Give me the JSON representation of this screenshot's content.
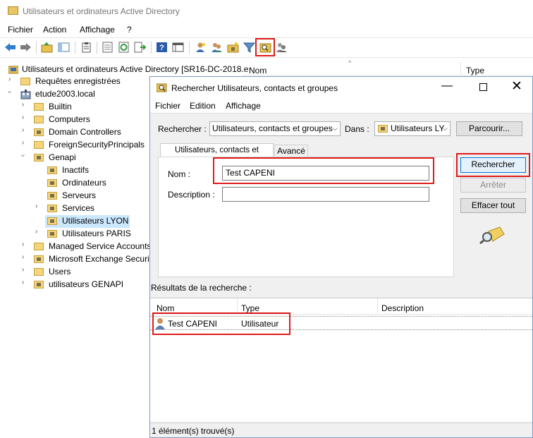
{
  "main_window": {
    "title": "Utilisateurs et ordinateurs Active Directory",
    "menu": [
      "Fichier",
      "Action",
      "Affichage",
      "?"
    ]
  },
  "tree": {
    "root": "Utilisateurs et ordinateurs Active Directory [SR16-DC-2018.e",
    "saved_queries": "Requêtes enregistrées",
    "domain": "etude2003.local",
    "items": [
      {
        "label": "Builtin"
      },
      {
        "label": "Computers"
      },
      {
        "label": "Domain Controllers"
      },
      {
        "label": "ForeignSecurityPrincipals"
      },
      {
        "label": "Genapi"
      },
      {
        "label": "Inactifs"
      },
      {
        "label": "Ordinateurs"
      },
      {
        "label": "Serveurs"
      },
      {
        "label": "Services"
      },
      {
        "label": "Utilisateurs LYON"
      },
      {
        "label": "Utilisateurs PARIS"
      },
      {
        "label": "Managed Service Accounts"
      },
      {
        "label": "Microsoft Exchange Securit"
      },
      {
        "label": "Users"
      },
      {
        "label": "utilisateurs GENAPI"
      }
    ]
  },
  "right_pane": {
    "col_name": "Nom",
    "col_type": "Type"
  },
  "dialog": {
    "title": "Rechercher Utilisateurs, contacts et groupes",
    "menu": [
      "Fichier",
      "Edition",
      "Affichage"
    ],
    "search_label": "Rechercher :",
    "search_value": "Utilisateurs, contacts et groupes",
    "in_label": "Dans :",
    "in_value": "Utilisateurs LY",
    "browse_button": "Parcourir...",
    "tabs": [
      "Utilisateurs, contacts et groupes",
      "Avancé"
    ],
    "name_label": "Nom :",
    "name_value": "Test CAPENI",
    "description_label": "Description :",
    "description_value": "",
    "search_button": "Rechercher",
    "stop_button": "Arrêter",
    "clear_button": "Effacer tout",
    "results_label": "Résultats de la recherche :",
    "results_columns": [
      "Nom",
      "Type",
      "Description"
    ],
    "results": [
      {
        "name": "Test CAPENI",
        "type": "Utilisateur",
        "description": ""
      }
    ],
    "status": "1 élément(s) trouvé(s)"
  },
  "colors": {
    "highlight_red": "#e01b1b",
    "selection_bg": "#cce8ff",
    "dialog_bg": "#f0f0f0",
    "folder_yellow": "#f4d57c"
  }
}
